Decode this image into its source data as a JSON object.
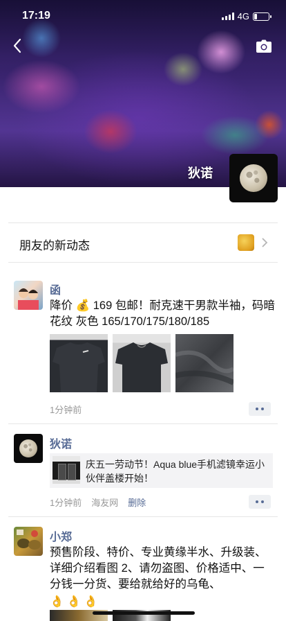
{
  "status_bar": {
    "time": "17:19",
    "network": "4G"
  },
  "cover": {
    "name": "狄诺"
  },
  "friends_news": {
    "label": "朋友的新动态"
  },
  "posts": [
    {
      "name": "函",
      "text": "降价 💰 169 包邮！耐克速干男款半袖，码暗花纹 灰色 165/170/175/180/185",
      "time": "1分钟前"
    },
    {
      "name": "狄诺",
      "share_title": "庆五一劳动节！Aqua blue手机滤镜幸运小伙伴盖楼开始！",
      "time": "1分钟前",
      "source": "海友网",
      "delete_label": "删除"
    },
    {
      "name": "小郑",
      "text": "预售阶段、特价、专业黄缘半水、升级装、详细介绍看图 2、请勿盗图、价格适中、一分钱一分货、要给就给好的乌龟、",
      "emoji": [
        "👌",
        "👌",
        "👌"
      ]
    }
  ],
  "colors": {
    "link": "#576b95",
    "meta": "#999999",
    "divider": "#e6e6e6"
  }
}
